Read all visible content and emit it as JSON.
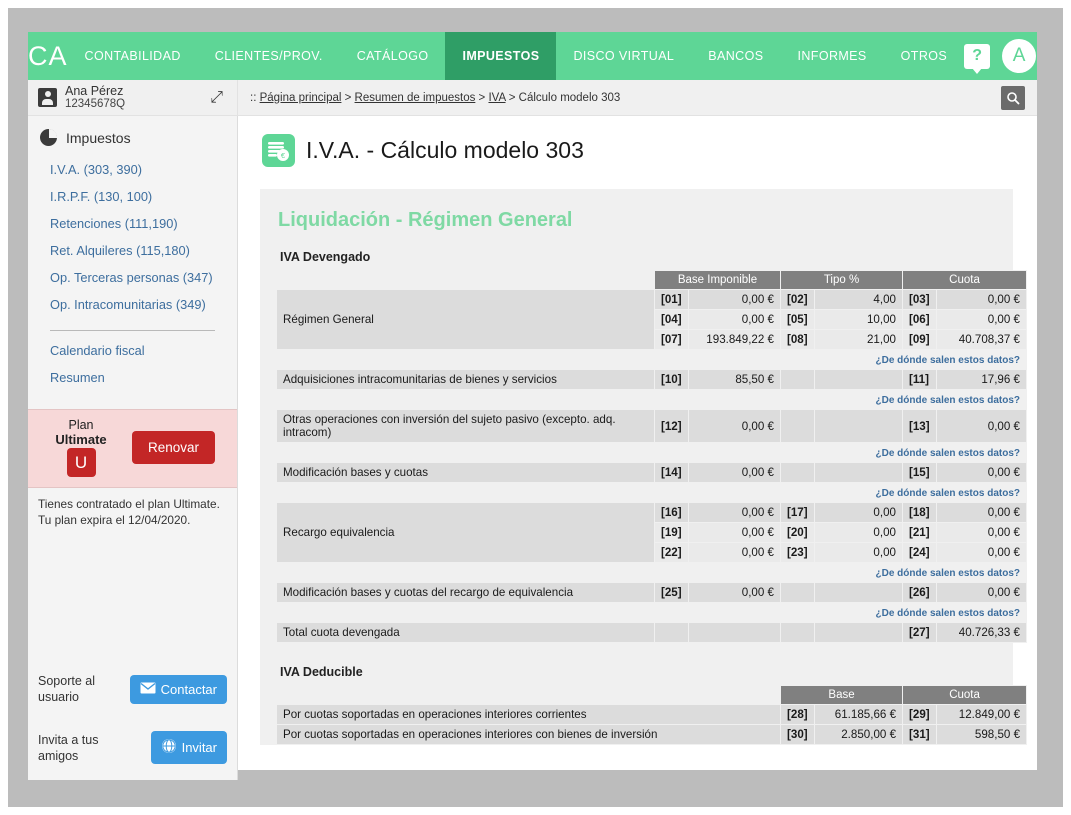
{
  "topnav": {
    "logo": "CA",
    "items": [
      {
        "label": "CONTABILIDAD",
        "active": false
      },
      {
        "label": "CLIENTES/PROV.",
        "active": false
      },
      {
        "label": "CATÁLOGO",
        "active": false
      },
      {
        "label": "IMPUESTOS",
        "active": true
      },
      {
        "label": "DISCO VIRTUAL",
        "active": false
      },
      {
        "label": "BANCOS",
        "active": false
      },
      {
        "label": "INFORMES",
        "active": false
      },
      {
        "label": "OTROS",
        "active": false
      }
    ],
    "help_label": "?",
    "avatar_initial": "A",
    "accent": "#5ed696",
    "accent_active": "#2f9e66"
  },
  "subbar": {
    "user_name": "Ana Pérez",
    "user_id": "12345678Q",
    "shuffle_icon": "shuffle-icon",
    "breadcrumb": {
      "prefix": "::",
      "items": [
        "Página principal",
        "Resumen de impuestos",
        "IVA",
        "Cálculo modelo 303"
      ],
      "separator": ">"
    },
    "search_icon": "search-icon"
  },
  "sidebar": {
    "heading": "Impuestos",
    "items": [
      "I.V.A. (303, 390)",
      "I.R.P.F. (130, 100)",
      "Retenciones (111,190)",
      "Ret. Alquileres (115,180)",
      "Op. Terceras personas (347)",
      "Op. Intracomunitarias (349)"
    ],
    "items2": [
      "Calendario fiscal",
      "Resumen"
    ],
    "plan": {
      "line1": "Plan",
      "line2": "Ultimate",
      "badge": "U",
      "button": "Renovar",
      "note": "Tienes contratado el plan Ultimate. Tu plan expira el 12/04/2020.",
      "button_color": "#c32626",
      "box_color": "#f7d8d8"
    },
    "support": {
      "label": "Soporte al usuario",
      "button": "Contactar",
      "icon": "envelope-icon"
    },
    "invite": {
      "label": "Invita a tus amigos",
      "button": "Invitar",
      "icon": "globe-icon"
    },
    "button_color": "#3d9ae0"
  },
  "main": {
    "icon": "invoice-euro-icon",
    "title": "I.V.A. - Cálculo modelo 303",
    "card_heading": "Liquidación - Régimen General",
    "heading_color": "#7fd9a4",
    "hint_text": "¿De dónde salen estos datos?",
    "section1": {
      "title": "IVA Devengado",
      "headers": [
        "Base Imponible",
        "Tipo %",
        "Cuota"
      ],
      "rows": [
        {
          "label": "Régimen General",
          "lines": [
            {
              "c1": "[01]",
              "v1": "0,00 €",
              "c2": "[02]",
              "v2": "4,00",
              "c3": "[03]",
              "v3": "0,00 €"
            },
            {
              "c1": "[04]",
              "v1": "0,00 €",
              "c2": "[05]",
              "v2": "10,00",
              "c3": "[06]",
              "v3": "0,00 €"
            },
            {
              "c1": "[07]",
              "v1": "193.849,22 €",
              "c2": "[08]",
              "v2": "21,00",
              "c3": "[09]",
              "v3": "40.708,37 €"
            }
          ]
        },
        {
          "label": "Adquisiciones intracomunitarias de bienes y servicios",
          "lines": [
            {
              "c1": "[10]",
              "v1": "85,50 €",
              "c2": "",
              "v2": "",
              "c3": "[11]",
              "v3": "17,96 €"
            }
          ]
        },
        {
          "label": "Otras operaciones con inversión del sujeto pasivo (excepto. adq. intracom)",
          "lines": [
            {
              "c1": "[12]",
              "v1": "0,00 €",
              "c2": "",
              "v2": "",
              "c3": "[13]",
              "v3": "0,00 €"
            }
          ]
        },
        {
          "label": "Modificación bases y cuotas",
          "lines": [
            {
              "c1": "[14]",
              "v1": "0,00 €",
              "c2": "",
              "v2": "",
              "c3": "[15]",
              "v3": "0,00 €"
            }
          ]
        },
        {
          "label": "Recargo equivalencia",
          "lines": [
            {
              "c1": "[16]",
              "v1": "0,00 €",
              "c2": "[17]",
              "v2": "0,00",
              "c3": "[18]",
              "v3": "0,00 €"
            },
            {
              "c1": "[19]",
              "v1": "0,00 €",
              "c2": "[20]",
              "v2": "0,00",
              "c3": "[21]",
              "v3": "0,00 €"
            },
            {
              "c1": "[22]",
              "v1": "0,00 €",
              "c2": "[23]",
              "v2": "0,00",
              "c3": "[24]",
              "v3": "0,00 €"
            }
          ]
        },
        {
          "label": "Modificación bases y cuotas del recargo de equivalencia",
          "lines": [
            {
              "c1": "[25]",
              "v1": "0,00 €",
              "c2": "",
              "v2": "",
              "c3": "[26]",
              "v3": "0,00 €"
            }
          ]
        },
        {
          "label": "Total cuota devengada",
          "no_hint": true,
          "lines": [
            {
              "c1": "",
              "v1": "",
              "c2": "",
              "v2": "",
              "c3": "[27]",
              "v3": "40.726,33 €"
            }
          ]
        }
      ]
    },
    "section2": {
      "title": "IVA Deducible",
      "headers": [
        "Base",
        "Cuota"
      ],
      "rows": [
        {
          "label": "Por cuotas soportadas en operaciones interiores corrientes",
          "c1": "[28]",
          "v1": "61.185,66 €",
          "c2": "[29]",
          "v2": "12.849,00 €"
        },
        {
          "label": "Por cuotas soportadas en operaciones interiores con bienes de inversión",
          "c1": "[30]",
          "v1": "2.850,00 €",
          "c2": "[31]",
          "v2": "598,50 €"
        }
      ]
    }
  }
}
